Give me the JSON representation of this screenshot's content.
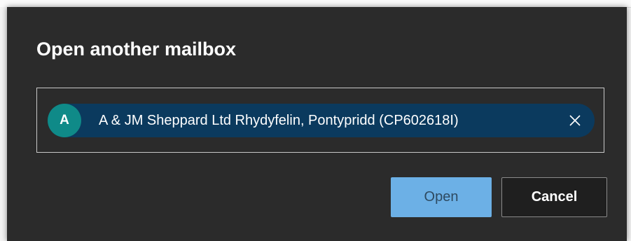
{
  "dialog": {
    "title": "Open another mailbox",
    "recipient": {
      "avatar_initial": "A",
      "name": "A & JM Sheppard Ltd Rhydyfelin, Pontypridd (CP602618I)",
      "remove_icon": "close-icon"
    },
    "buttons": {
      "open_label": "Open",
      "cancel_label": "Cancel"
    }
  },
  "colors": {
    "dialog_background": "#2b2b2b",
    "pill_background": "#0b3a5e",
    "avatar_background": "#0f8a88",
    "primary_button": "#6cb0e6"
  }
}
